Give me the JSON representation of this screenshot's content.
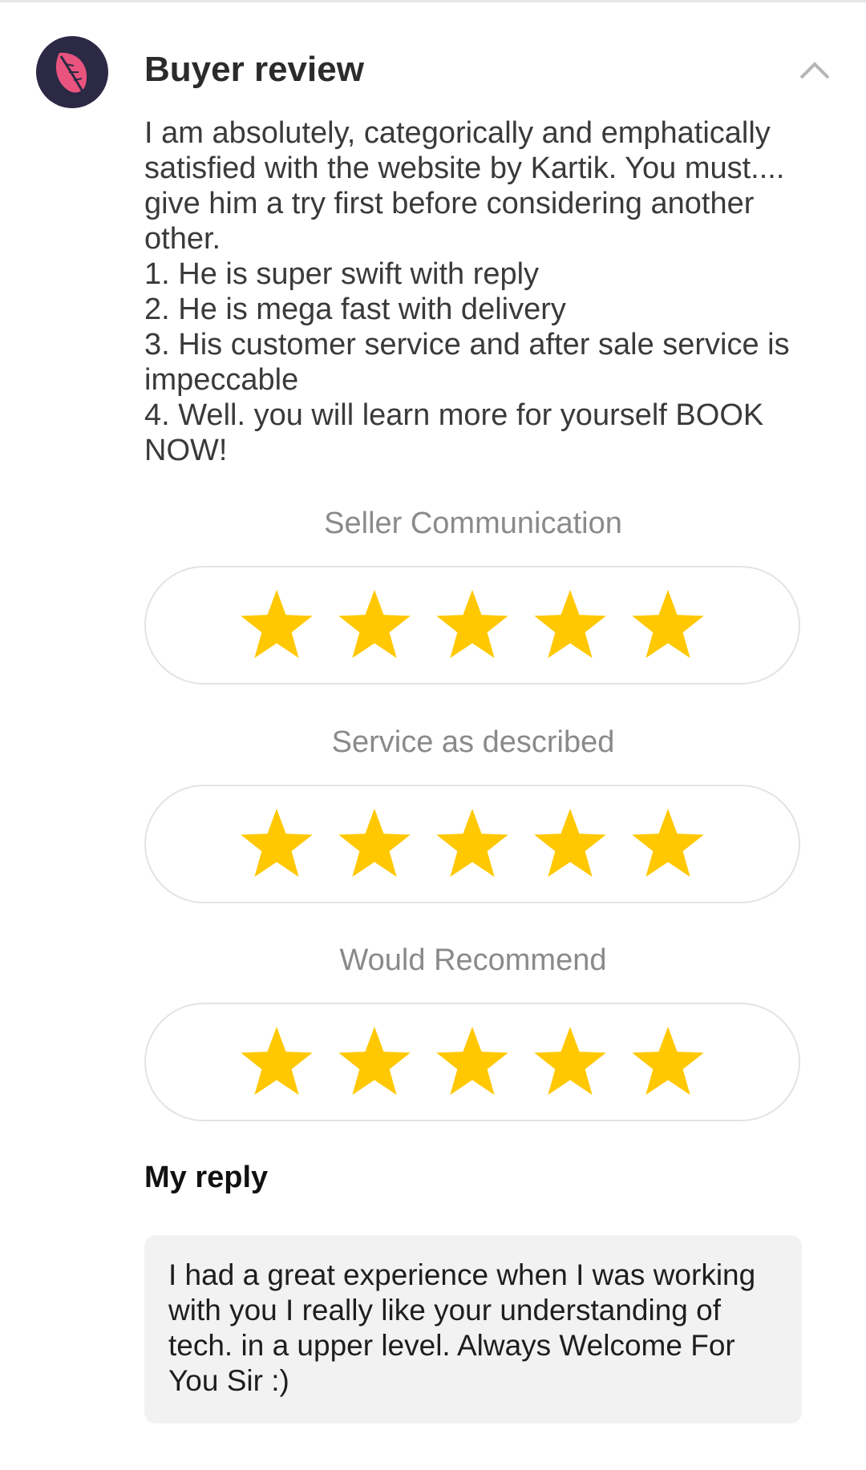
{
  "review": {
    "title": "Buyer review",
    "avatar_icon": "leaf-icon",
    "collapse_icon": "chevron-up-icon",
    "body": "I am absolutely, categorically and emphatically satisfied with the website by Kartik. You must.... give him a try first before considering another other.\n1. He is super swift with reply\n2. He is mega fast with delivery\n3. His customer service and after sale service is impeccable\n4. Well. you will learn more for yourself BOOK NOW!"
  },
  "ratings": [
    {
      "label": "Seller Communication",
      "stars": 5,
      "max": 5
    },
    {
      "label": "Service as described",
      "stars": 5,
      "max": 5
    },
    {
      "label": "Would Recommend",
      "stars": 5,
      "max": 5
    }
  ],
  "reply": {
    "title": "My reply",
    "text": "I had a great experience when I was working with you I really like your understanding of tech. in a upper level. Always Welcome For You Sir :)"
  },
  "colors": {
    "star": "#ffc800",
    "avatar_bg": "#2b2944",
    "avatar_leaf": "#e8547e"
  }
}
